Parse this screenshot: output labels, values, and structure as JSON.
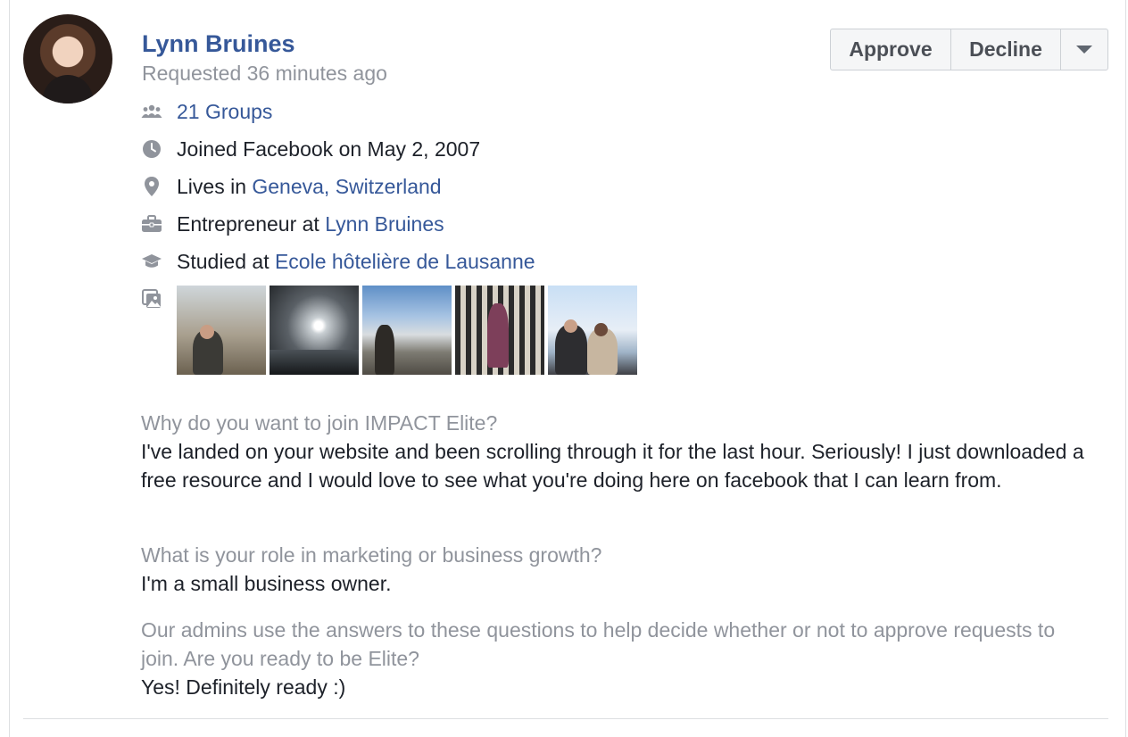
{
  "member_request": {
    "name": "Lynn Bruines",
    "requested": "Requested 36 minutes ago",
    "actions": {
      "approve": "Approve",
      "decline": "Decline"
    },
    "info": {
      "groups": "21 Groups",
      "joined": "Joined Facebook on May 2, 2007",
      "lives_prefix": "Lives in ",
      "lives_place": "Geneva, Switzerland",
      "work_prefix": "Entrepreneur at ",
      "work_place": "Lynn Bruines",
      "study_prefix": "Studied at ",
      "study_place": "Ecole hôtelière de Lausanne"
    },
    "questions": [
      {
        "question": "Why do you want to join IMPACT Elite?",
        "answer": "I've landed on your website and been scrolling through it for the last hour. Seriously! I just downloaded a free resource and I would love to see what you're doing here on facebook that I can learn from."
      },
      {
        "question": "What is your role in marketing or business growth?",
        "answer": "I'm a small business owner."
      },
      {
        "question": "Our admins use the answers to these questions to help decide whether or not to approve requests to join. Are you ready to be Elite?",
        "answer": "Yes! Definitely ready :)"
      }
    ]
  },
  "colors": {
    "link": "#365899",
    "muted": "#90949c",
    "text": "#1d2129",
    "icon": "#90949c"
  }
}
